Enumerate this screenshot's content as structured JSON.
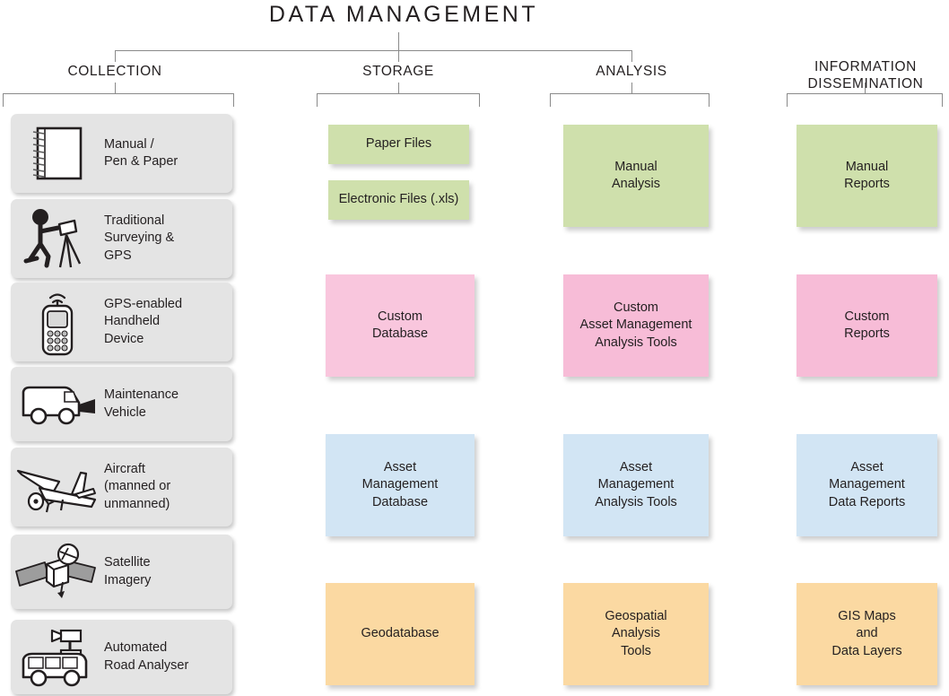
{
  "title": "DATA MANAGEMENT",
  "colors": {
    "green": "#cfe0ac",
    "pink_storage": "#f9c6dd",
    "pink_analysis": "#f7bcd7",
    "blue": "#d2e5f4",
    "orange": "#fbd9a2",
    "card_grey": "#e4e4e4",
    "line": "#8a8a8a",
    "text": "#231f20"
  },
  "headers": [
    {
      "label": "COLLECTION",
      "name": "collection"
    },
    {
      "label": "STORAGE",
      "name": "storage"
    },
    {
      "label": "ANALYSIS",
      "name": "analysis"
    },
    {
      "label": "INFORMATION\nDISSEMINATION",
      "name": "information-dissemination"
    }
  ],
  "collection": {
    "items": [
      {
        "label": "Manual /\nPen & Paper",
        "icon": "notebook-icon"
      },
      {
        "label": "Traditional\nSurveying &\nGPS",
        "icon": "surveyor-icon"
      },
      {
        "label": "GPS-enabled\nHandheld\nDevice",
        "icon": "handheld-device-icon"
      },
      {
        "label": "Maintenance\nVehicle",
        "icon": "van-icon"
      },
      {
        "label": "Aircraft\n(manned or\nunmanned)",
        "icon": "aircraft-icon"
      },
      {
        "label": "Satellite\nImagery",
        "icon": "satellite-icon"
      },
      {
        "label": "Automated\nRoad Analyser",
        "icon": "survey-van-icon"
      }
    ]
  },
  "storage": {
    "items": [
      {
        "label": "Paper Files",
        "color": "green"
      },
      {
        "label": "Electronic Files (.xls)",
        "color": "green"
      },
      {
        "label": "Custom\nDatabase",
        "color": "pink_storage"
      },
      {
        "label": "Asset\nManagement\nDatabase",
        "color": "blue"
      },
      {
        "label": "Geodatabase",
        "color": "orange"
      }
    ]
  },
  "analysis": {
    "items": [
      {
        "label": "Manual\nAnalysis",
        "color": "green"
      },
      {
        "label": "Custom\nAsset Management\nAnalysis Tools",
        "color": "pink_analysis"
      },
      {
        "label": "Asset\nManagement\nAnalysis Tools",
        "color": "blue"
      },
      {
        "label": "Geospatial\nAnalysis\nTools",
        "color": "orange"
      }
    ]
  },
  "dissemination": {
    "items": [
      {
        "label": "Manual\nReports",
        "color": "green"
      },
      {
        "label": "Custom\nReports",
        "color": "pink_analysis"
      },
      {
        "label": "Asset\nManagement\nData Reports",
        "color": "blue"
      },
      {
        "label": "GIS Maps\nand\nData Layers",
        "color": "orange"
      }
    ]
  }
}
